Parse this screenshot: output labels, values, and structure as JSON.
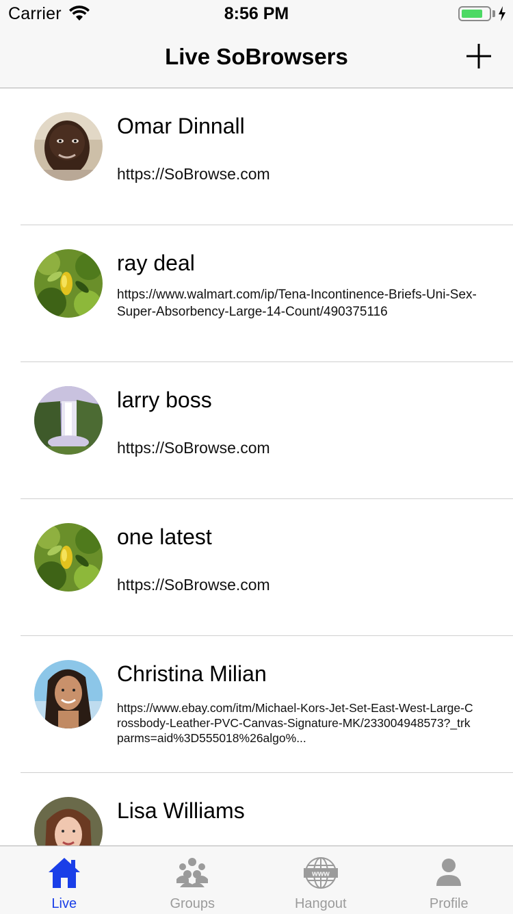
{
  "status_bar": {
    "carrier": "Carrier",
    "time": "8:56 PM",
    "battery_level": 0.8,
    "charging": true
  },
  "nav": {
    "title": "Live SoBrowsers",
    "add_icon": "plus-icon"
  },
  "browsers": [
    {
      "name": "Omar Dinnall",
      "url": "https://SoBrowse.com",
      "avatar": "man-portrait"
    },
    {
      "name": "ray deal",
      "url": "https://www.walmart.com/ip/Tena-Incontinence-Briefs-Uni-Sex-Super-Absorbency-Large-14-Count/490375116",
      "avatar": "lemon-tree"
    },
    {
      "name": "larry boss",
      "url": "https://SoBrowse.com",
      "avatar": "waterfall"
    },
    {
      "name": "one latest",
      "url": "https://SoBrowse.com",
      "avatar": "lemon-tree"
    },
    {
      "name": "Christina Milian",
      "url": "https://www.ebay.com/itm/Michael-Kors-Jet-Set-East-West-Large-Crossbody-Leather-PVC-Canvas-Signature-MK/233004948573?_trkparms=aid%3D555018%26algo%...",
      "avatar": "woman-portrait"
    },
    {
      "name": "Lisa Williams",
      "url": "",
      "avatar": "woman-portrait-2"
    }
  ],
  "tabs": [
    {
      "label": "Live",
      "icon": "home-icon",
      "active": true
    },
    {
      "label": "Groups",
      "icon": "group-icon",
      "active": false
    },
    {
      "label": "Hangout",
      "icon": "globe-www-icon",
      "active": false
    },
    {
      "label": "Profile",
      "icon": "person-icon",
      "active": false
    }
  ],
  "colors": {
    "active_tab": "#1a3fe8",
    "inactive_tab": "#9b9b9b",
    "battery": "#4cd964"
  }
}
